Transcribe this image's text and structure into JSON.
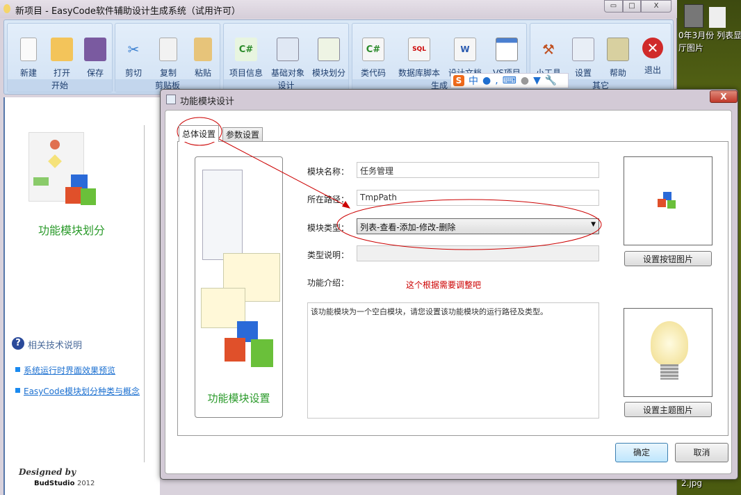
{
  "window": {
    "title": "新项目 - EasyCode软件辅助设计生成系统（试用许可）",
    "min": "▭",
    "max": "□",
    "close": "X"
  },
  "ribbon": {
    "groups": [
      {
        "label": "开始",
        "buttons": [
          "新建",
          "打开",
          "保存"
        ]
      },
      {
        "label": "剪贴板",
        "buttons": [
          "剪切",
          "复制",
          "粘贴"
        ]
      },
      {
        "label": "设计",
        "buttons": [
          "项目信息",
          "基础对象",
          "模块划分"
        ]
      },
      {
        "label": "生成",
        "buttons": [
          "类代码",
          "数据库脚本",
          "设计文档",
          "VS项目"
        ]
      },
      {
        "label": "其它",
        "buttons": [
          "小工具",
          "设置",
          "帮助",
          "退出"
        ]
      }
    ]
  },
  "ime": {
    "logo": "S",
    "mode": "中"
  },
  "left": {
    "title": "功能模块划分",
    "help_heading": "相关技术说明",
    "links": [
      "系统运行时界面效果预览",
      "EasyCode模块划分种类与概念"
    ],
    "designed_by": "Designed by",
    "studio": "BudStudio",
    "year": "2012"
  },
  "dialog": {
    "title": "功能模块设计",
    "close": "X",
    "tabs": [
      "总体设置",
      "参数设置"
    ],
    "image_caption": "功能模块设置",
    "fields": {
      "name_label": "模块名称：",
      "name_value": "任务管理",
      "path_label": "所在路径：",
      "path_value": "TmpPath",
      "type_label": "模块类型：",
      "type_value": "列表-查看-添加-修改-删除",
      "desc_label": "类型说明：",
      "desc_value": "",
      "intro_label": "功能介绍：",
      "intro_value": "该功能模块为一个空白模块，请您设置该功能模块的运行路径及类型。"
    },
    "annotation": "这个根据需要调整吧",
    "set_button_image": "设置按钮图片",
    "set_theme_image": "设置主题图片",
    "ok": "确定",
    "cancel": "取消"
  },
  "desktop": {
    "items": [
      "0年3月份 列表显",
      "厅图片",
      "2.jpg"
    ]
  },
  "colors": {
    "ribbon": "#cfdff0",
    "link": "#1a6fd0",
    "accent_green": "#2a9a2a",
    "annotation": "#cc0000"
  }
}
